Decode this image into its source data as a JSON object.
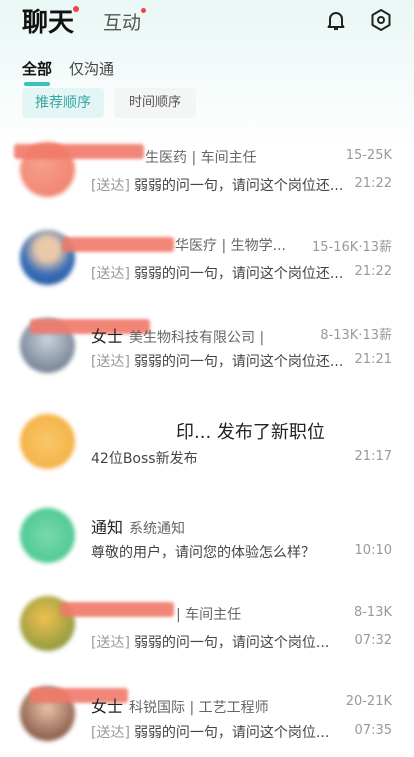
{
  "header": {
    "tab_chat": "聊天",
    "tab_interact": "互动",
    "bell_icon": "bell-icon",
    "settings_icon": "settings-icon"
  },
  "filters": {
    "all": "全部",
    "only_chat": "仅沟通"
  },
  "sort": {
    "recommend": "推荐顺序",
    "time": "时间顺序"
  },
  "conversations": [
    {
      "name": "",
      "company_role": "生医药 | 车间主任",
      "salary": "15-25K",
      "tag": "[送达]",
      "message": "弱弱的问一句，请问这个岗位还...",
      "time": "21:22"
    },
    {
      "name": "",
      "company_role": "华医疗 | 生物学...",
      "salary": "15-16K·13薪",
      "tag": "[送达]",
      "message": "弱弱的问一句，请问这个岗位还...",
      "time": "21:22"
    },
    {
      "name": "女士",
      "company_role": "美生物科技有限公司 |",
      "salary": "8-13K·13薪",
      "tag": "[送达]",
      "message": "弱弱的问一句，请问这个岗位还...",
      "time": "21:21"
    },
    {
      "title": "印... 发布了新职位",
      "subtitle": "42位Boss新发布",
      "time": "21:17"
    },
    {
      "name": "通知",
      "company_role": "系统通知",
      "message": "尊敬的用户，请问您的体验怎么样？",
      "time": "10:10"
    },
    {
      "name": "",
      "company_role": "| 车间主任",
      "salary": "8-13K",
      "tag": "[送达]",
      "message": "弱弱的问一句，请问这个岗位...",
      "time": "07:32"
    },
    {
      "name": "女士",
      "company_role": "科锐国际 | 工艺工程师",
      "salary": "20-21K",
      "tag": "[送达]",
      "message": "弱弱的问一句，请问这个岗位...",
      "time": "07:35"
    }
  ],
  "colors": {
    "accent": "#37c2bc",
    "badge": "#f04444",
    "redaction": "#f07a6a"
  }
}
